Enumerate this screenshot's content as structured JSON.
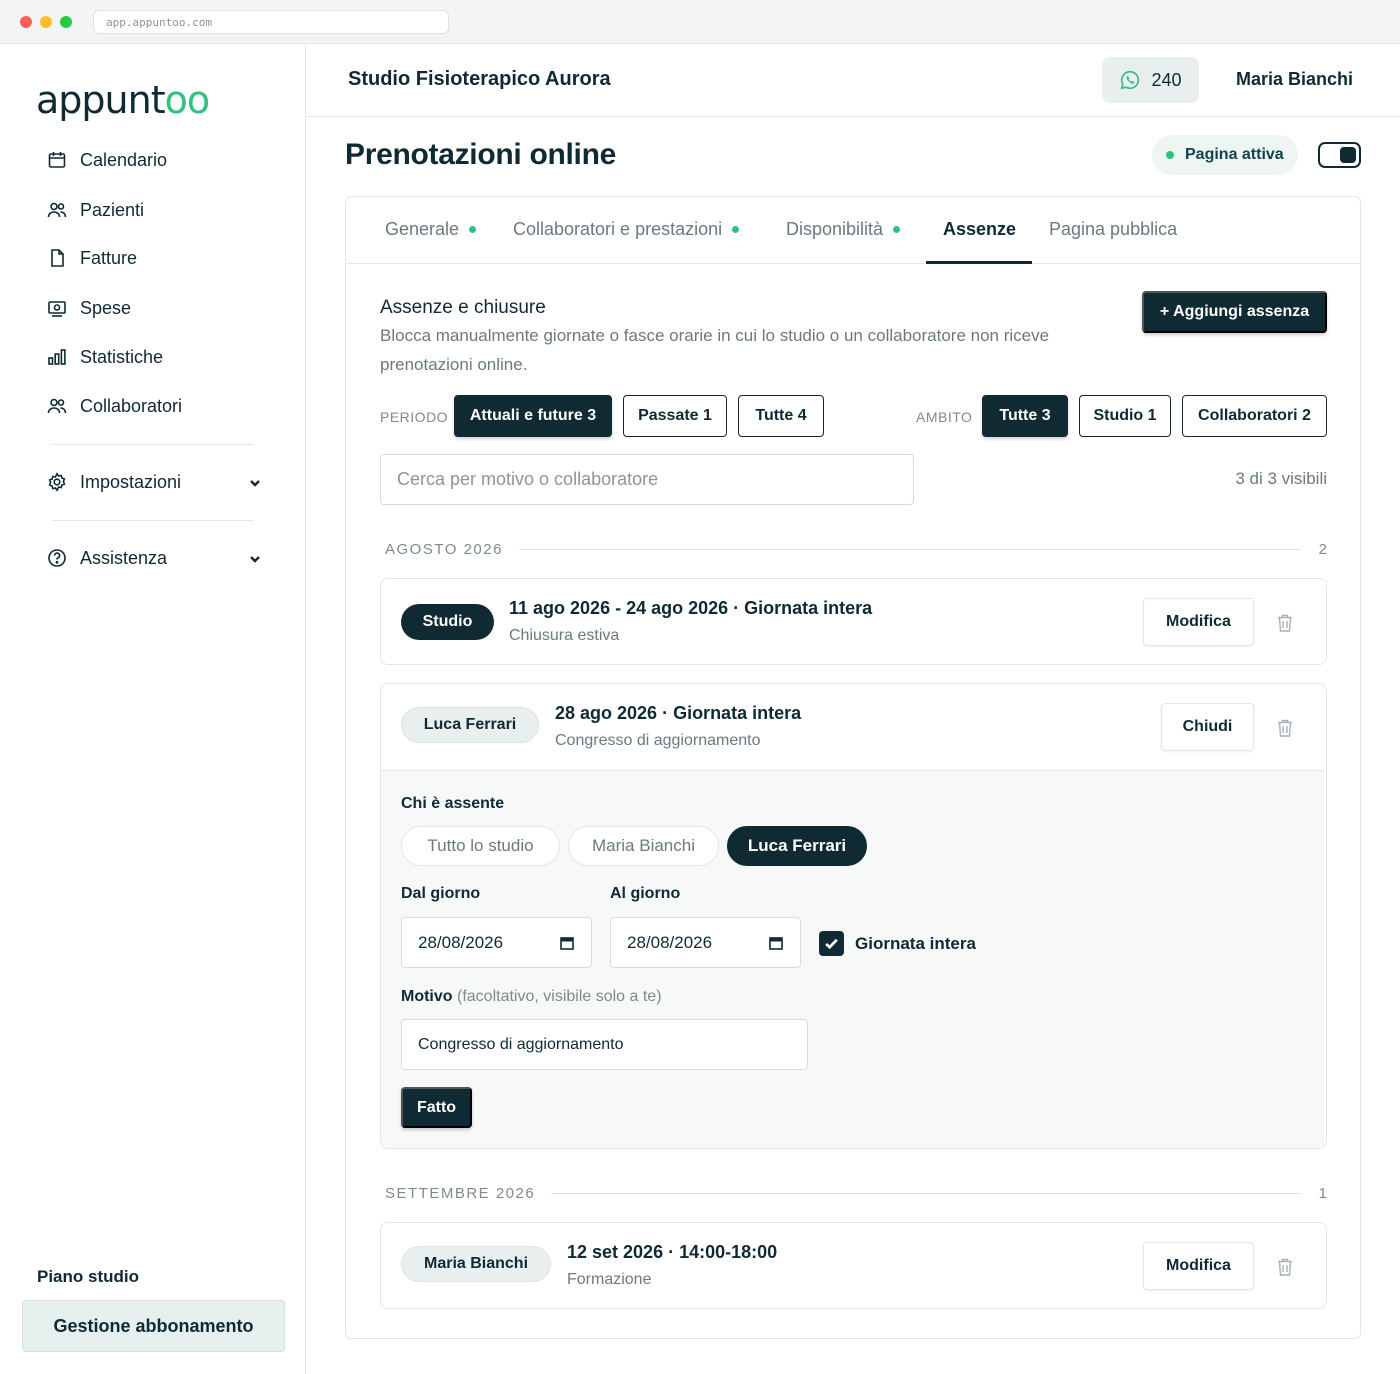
{
  "browser": {
    "url": "app.appuntoo.com"
  },
  "sidebar": {
    "logo_main": "appunt",
    "logo_accent": "oo",
    "items": [
      {
        "label": "Calendario",
        "icon": "calendar-icon"
      },
      {
        "label": "Pazienti",
        "icon": "users-icon"
      },
      {
        "label": "Fatture",
        "icon": "file-icon"
      },
      {
        "label": "Spese",
        "icon": "receipt-icon"
      },
      {
        "label": "Statistiche",
        "icon": "bar-chart-icon"
      },
      {
        "label": "Collaboratori",
        "icon": "users-icon"
      }
    ],
    "settings": {
      "label": "Impostazioni",
      "icon": "gear-icon"
    },
    "help": {
      "label": "Assistenza",
      "icon": "help-circle-icon"
    },
    "plan_label": "Piano studio",
    "plan_button": "Gestione abbonamento"
  },
  "header": {
    "studio_name": "Studio Fisioterapico Aurora",
    "whatsapp_count": "240",
    "user_name": "Maria Bianchi"
  },
  "page": {
    "title": "Prenotazioni online",
    "status": "Pagina attiva",
    "toggle_on": true
  },
  "tabs": [
    {
      "label": "Generale",
      "dot": true
    },
    {
      "label": "Collaboratori e prestazioni",
      "dot": true
    },
    {
      "label": "Disponibilità",
      "dot": true
    },
    {
      "label": "Assenze",
      "active": true
    },
    {
      "label": "Pagina pubblica"
    }
  ],
  "section": {
    "title": "Assenze e chiusure",
    "description": "Blocca manualmente giornate o fasce orarie in cui lo studio o un collaboratore non riceve prenotazioni online.",
    "add_button": "+ Aggiungi assenza"
  },
  "filters": {
    "period_label": "PERIODO",
    "period": [
      "Attuali e future 3",
      "Passate 1",
      "Tutte 4"
    ],
    "scope_label": "AMBITO",
    "scope": [
      "Tutte 3",
      "Studio 1",
      "Collaboratori 2"
    ]
  },
  "search": {
    "placeholder": "Cerca per motivo o collaboratore",
    "visible_text": "3 di 3 visibili"
  },
  "groups": [
    {
      "label": "AGOSTO 2026",
      "count": "2"
    },
    {
      "label": "SETTEMBRE 2026",
      "count": "1"
    }
  ],
  "absences": [
    {
      "who": "Studio",
      "title": "11 ago 2026 - 24 ago 2026 · Giornata intera",
      "reason": "Chiusura estiva",
      "action": "Modifica"
    },
    {
      "who": "Luca Ferrari",
      "title": "28 ago 2026 · Giornata intera",
      "reason": "Congresso di aggiornamento",
      "action": "Chiudi"
    },
    {
      "who": "Maria Bianchi",
      "title": "12 set 2026 · 14:00-18:00",
      "reason": "Formazione",
      "action": "Modifica"
    }
  ],
  "editor": {
    "who_label": "Chi è assente",
    "who_options": [
      "Tutto lo studio",
      "Maria Bianchi",
      "Luca Ferrari"
    ],
    "from_label": "Dal giorno",
    "from_value": "28/08/2026",
    "to_label": "Al giorno",
    "to_value": "28/08/2026",
    "full_day_label": "Giornata intera",
    "reason_label": "Motivo",
    "reason_hint": "(facoltativo, visibile solo a te)",
    "reason_value": "Congresso di aggiornamento",
    "done_button": "Fatto"
  },
  "colors": {
    "primary": "#0f2a33",
    "accent": "#2ec27e",
    "muted": "#6b7a80"
  }
}
